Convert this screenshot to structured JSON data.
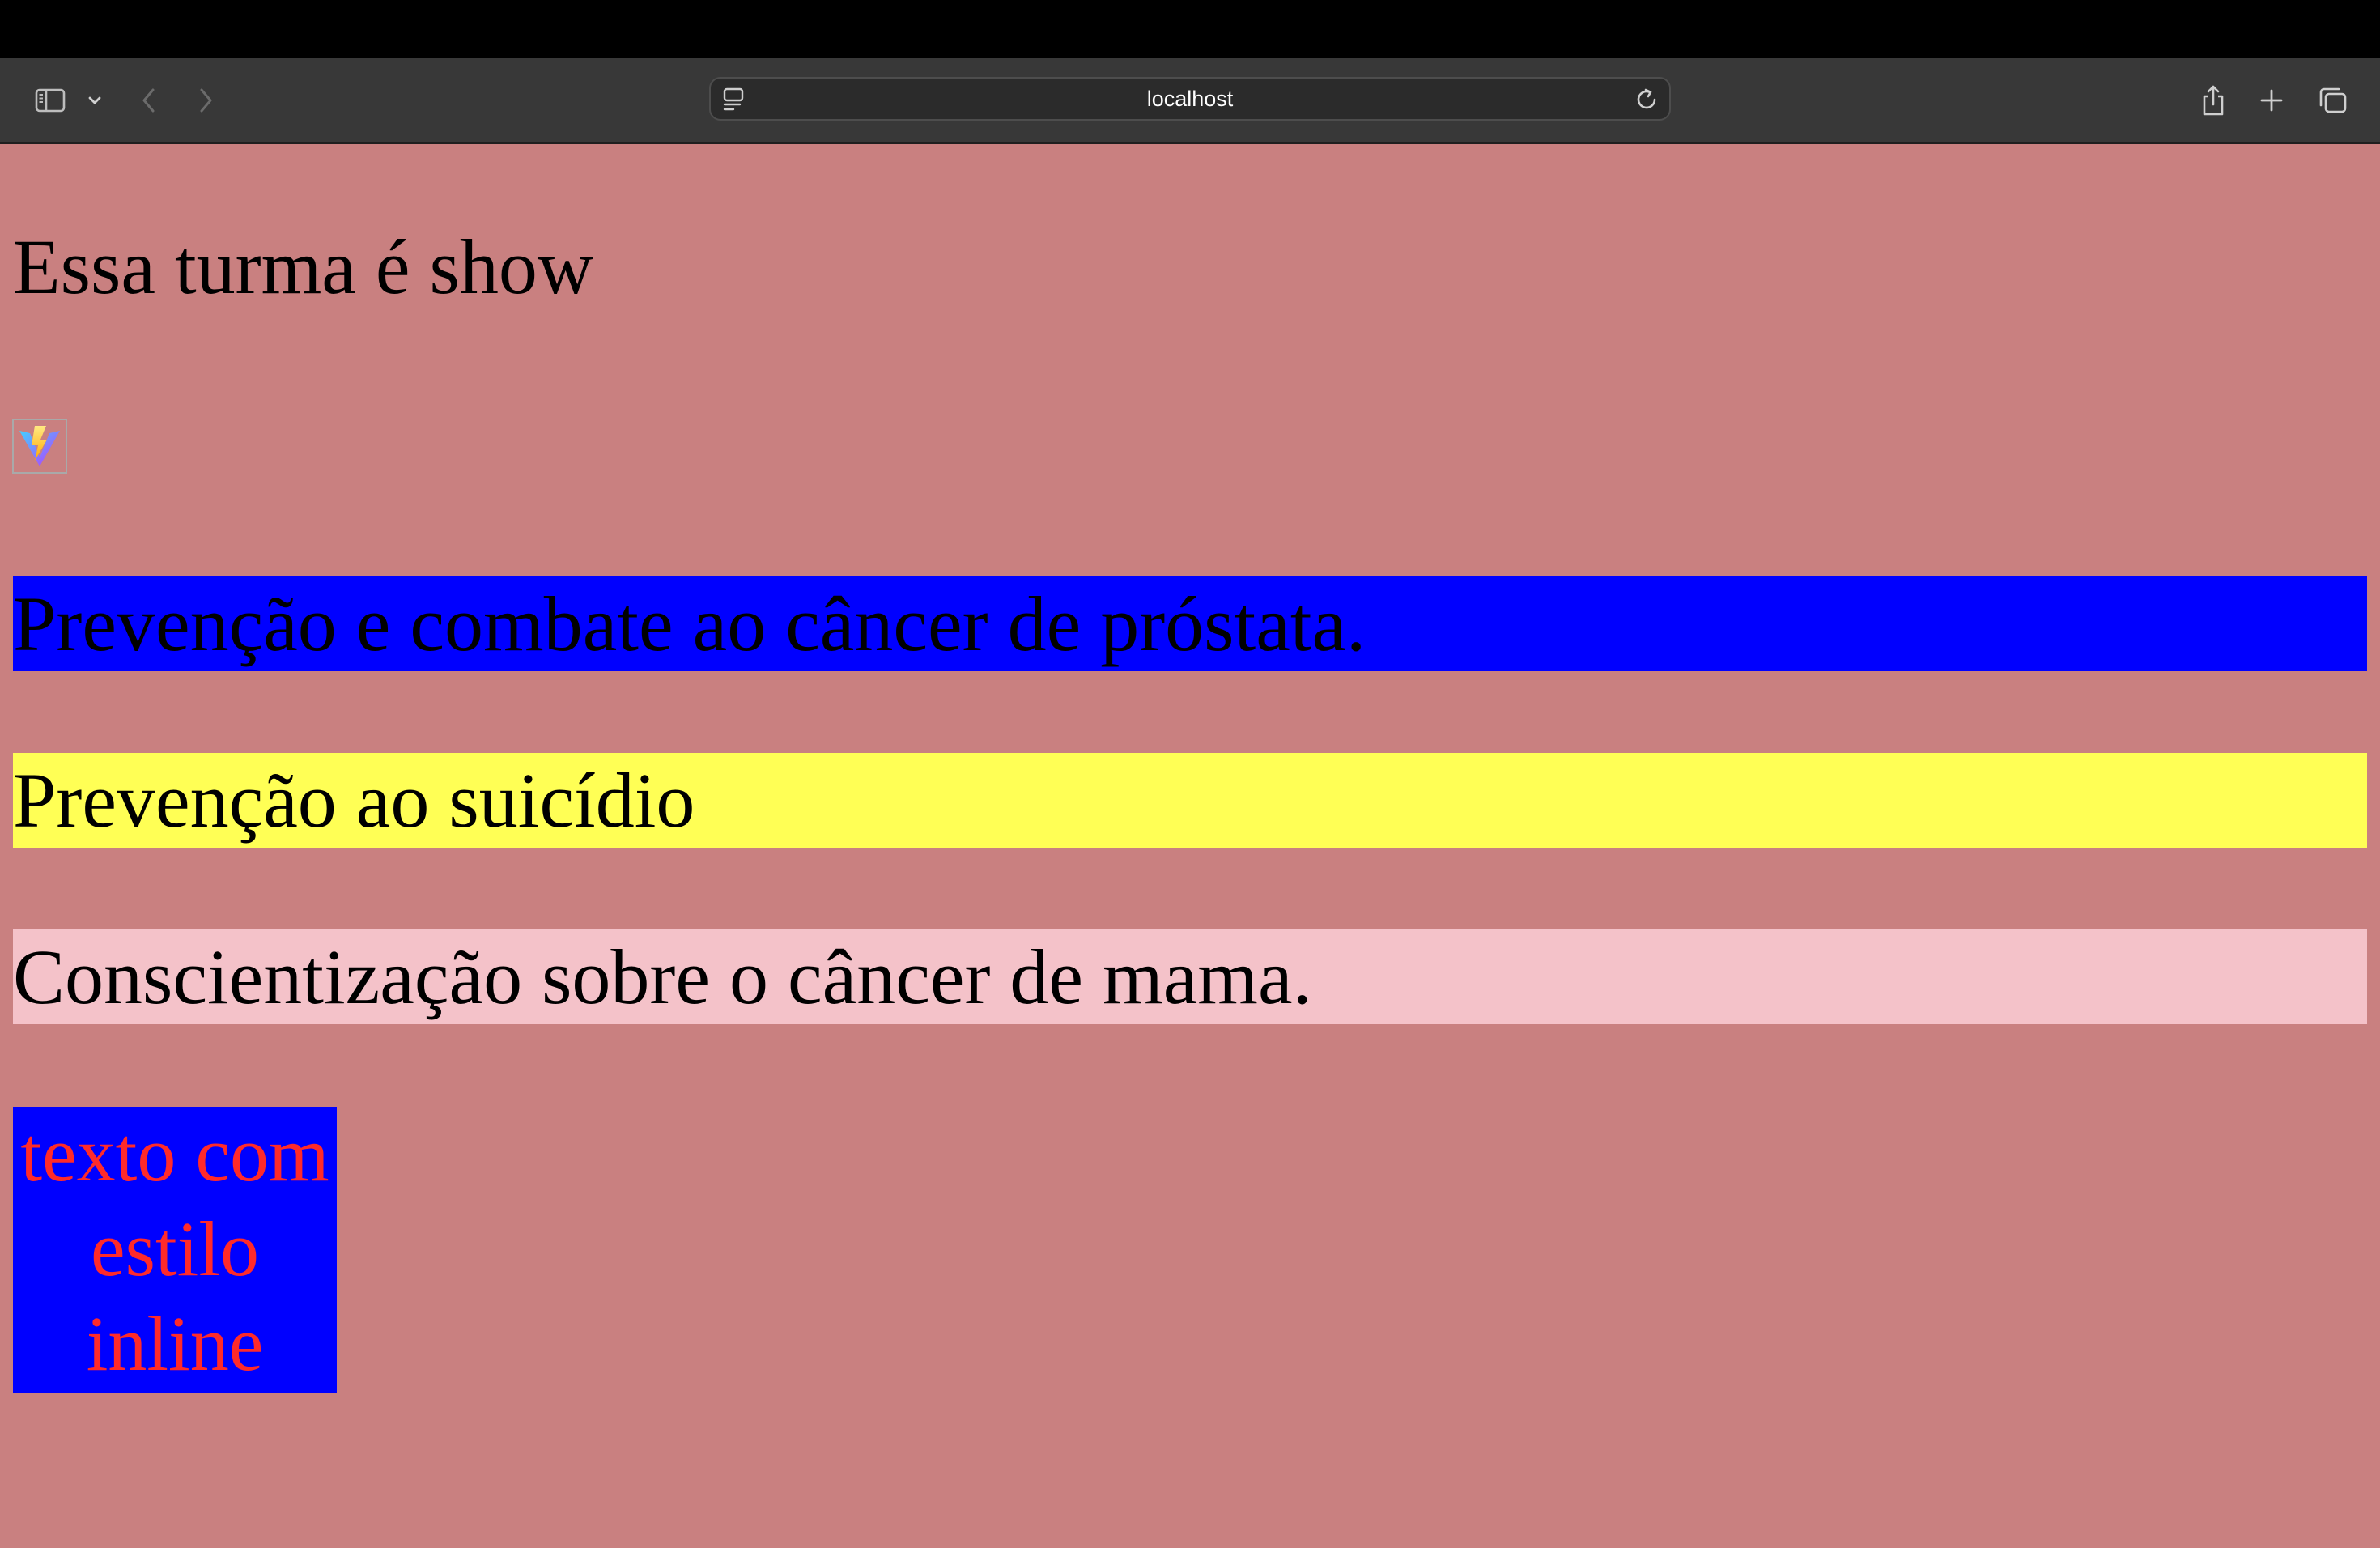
{
  "browser": {
    "url": "localhost",
    "icons": {
      "sidebar": "sidebar-icon",
      "sidebar_menu": "chevron-down-icon",
      "back": "chevron-left-icon",
      "forward": "chevron-right-icon",
      "site": "page-menu-icon",
      "reload": "reload-icon",
      "share": "share-icon",
      "new_tab": "plus-icon",
      "tabs": "tab-overview-icon"
    }
  },
  "page": {
    "background": "#c98080",
    "heading": "Essa turma é show",
    "image_icon": "vite-logo-icon",
    "banners": [
      {
        "text": "Prevenção e combate ao câncer de próstata.",
        "background": "#0000ff"
      },
      {
        "text": "Prevenção ao suicídio",
        "background": "#ffff55"
      },
      {
        "text": "Conscientização sobre o câncer de mama.",
        "background": "#f4c2c9"
      }
    ],
    "inline_box": {
      "text": "texto com estilo inline",
      "background": "#0000ff",
      "color": "#ff2a2a"
    }
  }
}
